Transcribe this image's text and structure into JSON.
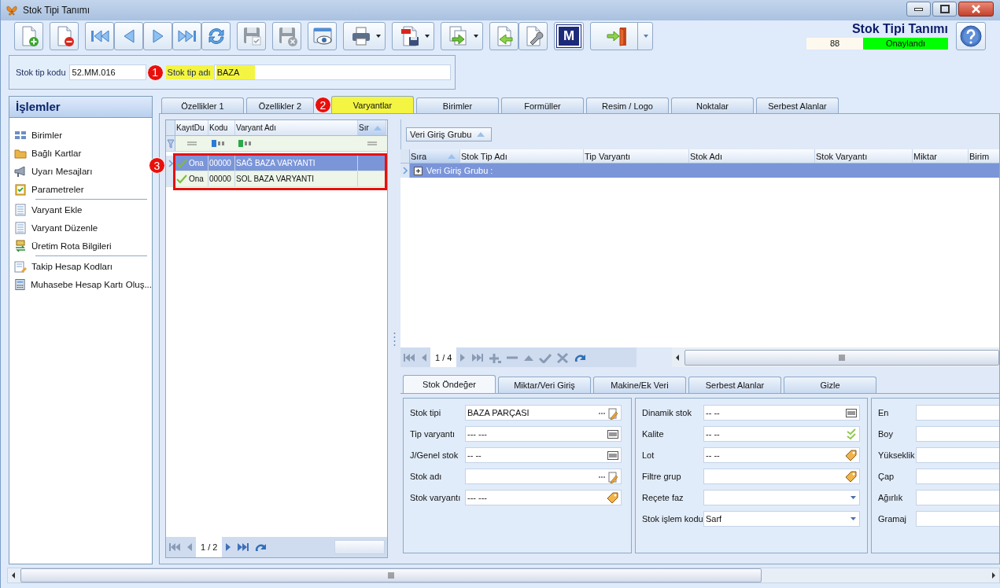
{
  "window": {
    "title": "Stok Tipi Tanımı"
  },
  "toolbar": {
    "groups": [
      {
        "buttons": [
          {
            "kind": "new",
            "disabled": false,
            "dropdown": false
          }
        ]
      },
      {
        "buttons": [
          {
            "kind": "delete",
            "disabled": false,
            "dropdown": false
          }
        ]
      },
      {
        "buttons": [
          {
            "kind": "first",
            "disabled": false,
            "dropdown": false
          },
          {
            "kind": "prev",
            "disabled": false,
            "dropdown": false
          },
          {
            "kind": "next",
            "disabled": false,
            "dropdown": false
          },
          {
            "kind": "last",
            "disabled": false,
            "dropdown": false
          },
          {
            "kind": "refresh",
            "disabled": false,
            "dropdown": false
          }
        ]
      },
      {
        "buttons": [
          {
            "kind": "save",
            "disabled": true,
            "dropdown": false
          }
        ]
      },
      {
        "buttons": [
          {
            "kind": "cancel",
            "disabled": true,
            "dropdown": false
          }
        ]
      },
      {
        "buttons": [
          {
            "kind": "preview",
            "disabled": false,
            "dropdown": false
          }
        ]
      },
      {
        "buttons": [
          {
            "kind": "print",
            "disabled": false,
            "dropdown": true
          }
        ]
      },
      {
        "buttons": [
          {
            "kind": "pdf",
            "disabled": false,
            "dropdown": true
          }
        ]
      },
      {
        "buttons": [
          {
            "kind": "export",
            "disabled": false,
            "dropdown": true
          }
        ]
      },
      {
        "buttons": [
          {
            "kind": "import",
            "disabled": false,
            "dropdown": false
          },
          {
            "kind": "tools",
            "disabled": false,
            "dropdown": false
          }
        ]
      },
      {
        "buttons": [
          {
            "kind": "m",
            "label": "M",
            "disabled": false,
            "dropdown": false
          }
        ]
      },
      {
        "buttons": [
          {
            "kind": "exit",
            "disabled": false,
            "dropdown": true
          }
        ]
      }
    ]
  },
  "header": {
    "title": "Stok Tipi Tanımı",
    "number": "88",
    "status": "Onaylandı"
  },
  "form": [
    {
      "label": "Stok tip kodu",
      "value": "52.MM.016",
      "highlighted": false
    },
    {
      "label": "Stok tip adı",
      "value": "BAZA",
      "highlighted": true,
      "annotation": "1"
    }
  ],
  "sidebar": {
    "title": "İşlemler",
    "groups": [
      [
        "Birimler",
        "Bağlı Kartlar",
        "Uyarı Mesajları",
        "Parametreler"
      ],
      [
        "Varyant Ekle",
        "Varyant Düzenle",
        "Üretim Rota Bilgileri"
      ],
      [
        "Takip Hesap Kodları",
        "Muhasebe Hesap Kartı Oluş..."
      ]
    ]
  },
  "tabs": [
    {
      "label": "Özellikler 1",
      "selected": false,
      "highlighted": false
    },
    {
      "label": "Özellikler 2",
      "selected": false,
      "highlighted": false
    },
    {
      "label": "Varyantlar",
      "selected": true,
      "highlighted": true,
      "annotation": "2"
    },
    {
      "label": "Birimler",
      "selected": false,
      "highlighted": false
    },
    {
      "label": "Formüller",
      "selected": false,
      "highlighted": false
    },
    {
      "label": "Resim / Logo",
      "selected": false,
      "highlighted": false
    },
    {
      "label": "Noktalar",
      "selected": false,
      "highlighted": false
    },
    {
      "label": "Serbest Alanlar",
      "selected": false,
      "highlighted": false
    }
  ],
  "variants_grid": {
    "columns": [
      {
        "label": "KayıtDu",
        "sorted": false
      },
      {
        "label": "Kodu",
        "sorted": false
      },
      {
        "label": "Varyant Adı",
        "sorted": false
      },
      {
        "label": "Sır",
        "sorted": true
      }
    ],
    "rows": [
      {
        "status": "Ona",
        "approved": true,
        "code": "00000",
        "name": "SAĞ BAZA VARYANTI",
        "selected": true
      },
      {
        "status": "Ona",
        "approved": true,
        "code": "00000",
        "name": "SOL BAZA VARYANTI",
        "selected": false
      }
    ],
    "annotation": "3",
    "pager": "1 / 2"
  },
  "entry_grid": {
    "group_panel": {
      "label": "Veri Giriş Grubu",
      "sorted": true
    },
    "columns": [
      {
        "label": "Sıra",
        "sorted": true
      },
      {
        "label": "Stok Tip Adı",
        "sorted": false
      },
      {
        "label": "Tip Varyantı",
        "sorted": false
      },
      {
        "label": "Stok Adı",
        "sorted": false
      },
      {
        "label": "Stok Varyantı",
        "sorted": false
      },
      {
        "label": "Miktar",
        "sorted": false
      },
      {
        "label": "Birim",
        "sorted": false
      }
    ],
    "group_row": {
      "label": "Veri Giriş Grubu :",
      "selected": true,
      "expanded": false
    },
    "pager": "1 / 4"
  },
  "detail_tabs": [
    {
      "label": "Stok Öndeğer",
      "selected": true
    },
    {
      "label": "Miktar/Veri Giriş",
      "selected": false
    },
    {
      "label": "Makine/Ek Veri",
      "selected": false
    },
    {
      "label": "Serbest Alanlar",
      "selected": false
    },
    {
      "label": "Gizle",
      "selected": false
    }
  ],
  "detail_panels": [
    {
      "fields": [
        {
          "label": "Stok tipi",
          "value": "BAZA PARÇASI",
          "kind": "picker"
        },
        {
          "label": "Tip varyantı",
          "value": "--- ---",
          "kind": "barcode"
        },
        {
          "label": "J/Genel stok",
          "value": "-- --",
          "kind": "barcode"
        },
        {
          "label": "Stok adı",
          "kind": "picker"
        },
        {
          "label": "Stok varyantı",
          "value": "--- ---",
          "kind": "tag"
        }
      ]
    },
    {
      "fields": [
        {
          "label": "Dinamik stok",
          "value": "-- --",
          "kind": "barcode"
        },
        {
          "label": "Kalite",
          "value": "-- --",
          "kind": "check"
        },
        {
          "label": "Lot",
          "value": "-- --",
          "kind": "tag"
        },
        {
          "label": "Filtre grup",
          "kind": "tag"
        },
        {
          "label": "Reçete faz",
          "kind": "dropdown"
        },
        {
          "label": "Stok işlem kodu",
          "value": "Sarf",
          "kind": "dropdown"
        }
      ]
    },
    {
      "fields": [
        {
          "label": "En",
          "kind": "plain"
        },
        {
          "label": "Boy",
          "kind": "plain"
        },
        {
          "label": "Yükseklik",
          "kind": "plain"
        },
        {
          "label": "Çap",
          "kind": "plain"
        },
        {
          "label": "Ağırlık",
          "kind": "plain"
        },
        {
          "label": "Gramaj",
          "kind": "plain"
        }
      ]
    }
  ]
}
